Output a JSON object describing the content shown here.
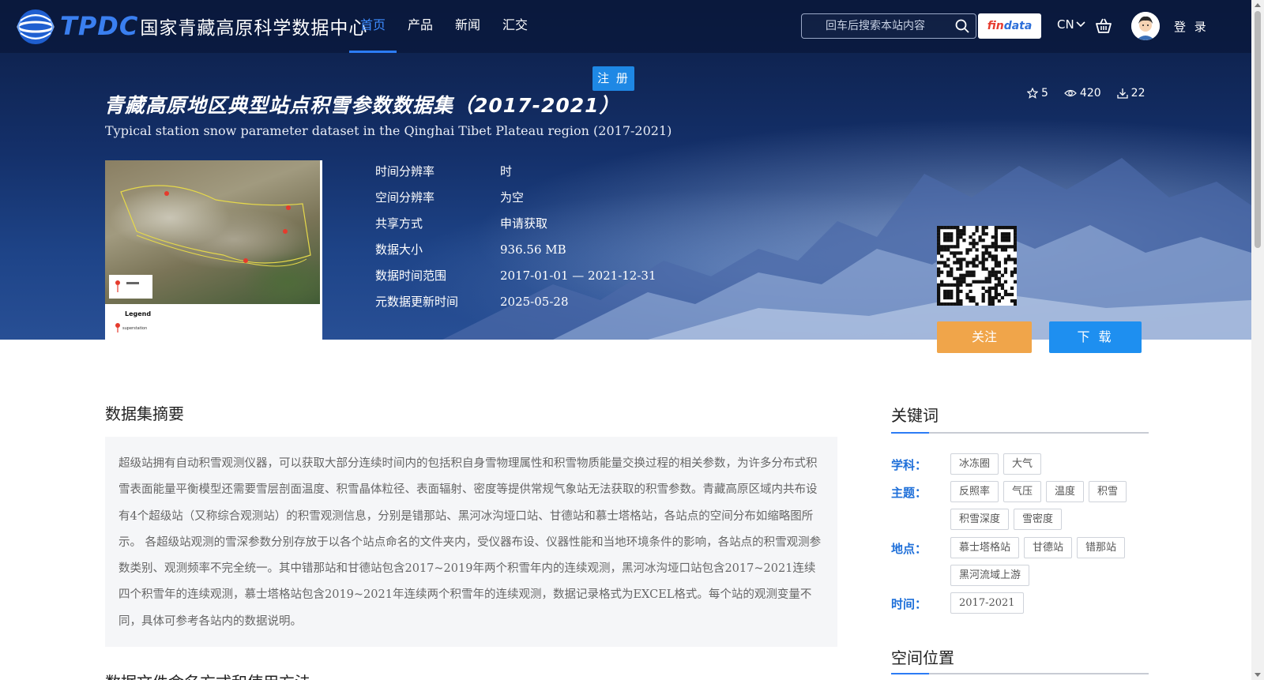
{
  "header": {
    "logo_text": "TPDC",
    "logo_cn": "国家青藏高原科学数据中心",
    "nav": [
      {
        "label": "首页",
        "active": true
      },
      {
        "label": "产品",
        "active": false
      },
      {
        "label": "新闻",
        "active": false
      },
      {
        "label": "汇交",
        "active": false
      }
    ],
    "search_placeholder": "回车后搜索本站内容",
    "findata": {
      "part1": "fin",
      "part2": "data"
    },
    "lang": "CN",
    "login": "登 录"
  },
  "register_label": "注 册",
  "dataset": {
    "title_cn": "青藏高原地区典型站点积雪参数数据集（2017-2021）",
    "title_en": "Typical station snow parameter dataset in the Qinghai Tibet Plateau region (2017-2021)",
    "stats": {
      "stars": "5",
      "views": "420",
      "downloads": "22"
    },
    "thumbnail_legend": "Legend",
    "thumbnail_legend_item": "superstation",
    "info": [
      {
        "label": "时间分辨率",
        "value": "时"
      },
      {
        "label": "空间分辨率",
        "value": "为空"
      },
      {
        "label": "共享方式",
        "value": "申请获取"
      },
      {
        "label": "数据大小",
        "value": "936.56 MB"
      },
      {
        "label": "数据时间范围",
        "value": "2017-01-01 — 2021-12-31"
      },
      {
        "label": "元数据更新时间",
        "value": "2025-05-28"
      }
    ],
    "follow_label": "关注",
    "download_label": "下 载"
  },
  "abstract": {
    "title": "数据集摘要",
    "text": "超级站拥有自动积雪观测仪器，可以获取大部分连续时间内的包括积自身雪物理属性和积雪物质能量交换过程的相关参数，为许多分布式积雪表面能量平衡模型还需要雪层剖面温度、积雪晶体粒径、表面辐射、密度等提供常规气象站无法获取的积雪参数。青藏高原区域内共布设有4个超级站（又称综合观测站）的积雪观测信息，分别是错那站、黑河冰沟垭口站、甘德站和慕士塔格站，各站点的空间分布如缩略图所示。 各超级站观测的雪深参数分别存放于以各个站点命名的文件夹内，受仪器布设、仪器性能和当地环境条件的影响，各站点的积雪观测参数类别、观测频率不完全统一。其中错那站和甘德站包含2017~2019年两个积雪年内的连续观测，黑河冰沟垭口站包含2017~2021连续四个积雪年的连续观测，慕士塔格站包含2019~2021年连续两个积雪年的连续观测，数据记录格式为EXCEL格式。每个站的观测变量不同，具体可参考各站内的数据说明。"
  },
  "next_section_title": "数据文件命名方式和使用方法",
  "keywords": {
    "title": "关键词",
    "groups": [
      {
        "label": "学科：",
        "tags": [
          "冰冻圈",
          "大气"
        ]
      },
      {
        "label": "主题：",
        "tags": [
          "反照率",
          "气压",
          "温度",
          "积雪",
          "积雪深度",
          "雪密度"
        ]
      },
      {
        "label": "地点：",
        "tags": [
          "慕士塔格站",
          "甘德站",
          "错那站",
          "黑河流域上游"
        ]
      },
      {
        "label": "时间：",
        "tags": [
          "2017-2021"
        ]
      }
    ]
  },
  "space_title": "空间位置",
  "colors": {
    "accent": "#2c7cf5",
    "follow": "#f0a54a",
    "download": "#1e8ff0",
    "register": "#1e88e5"
  }
}
